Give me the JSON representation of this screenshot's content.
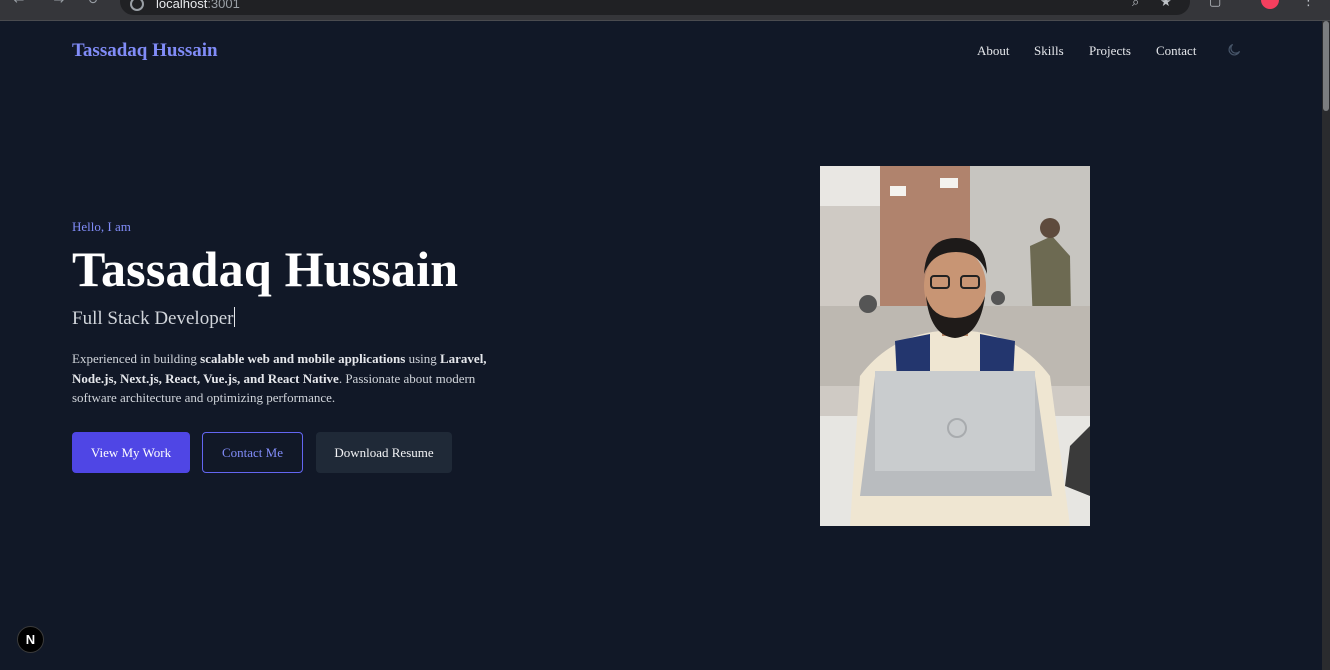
{
  "browser": {
    "url_host": "localhost",
    "url_port": ":3001"
  },
  "site": {
    "brand": "Tassadaq Hussain",
    "nav": [
      "About",
      "Skills",
      "Projects",
      "Contact"
    ]
  },
  "hero": {
    "greeting": "Hello, I am",
    "name": "Tassadaq Hussain",
    "role": "Full Stack Developer",
    "desc_1": "Experienced in building ",
    "desc_b1": "scalable web and mobile applications",
    "desc_2": " using ",
    "desc_b2": "Laravel, Node.js, Next.js, React, Vue.js, and React Native",
    "desc_3": ". Passionate about modern software architecture and optimizing performance.",
    "btn_work": "View My Work",
    "btn_contact": "Contact Me",
    "btn_resume": "Download Resume"
  },
  "badge": "N",
  "colors": {
    "background": "#111827",
    "accent": "#818cf8",
    "primary_button": "#4f46e5",
    "dark_button": "#1f2937"
  },
  "icons": [
    "back-arrow-icon",
    "forward-arrow-icon",
    "reload-icon",
    "site-info-icon",
    "bookmark-star-icon",
    "moon-icon",
    "nextjs-icon"
  ]
}
